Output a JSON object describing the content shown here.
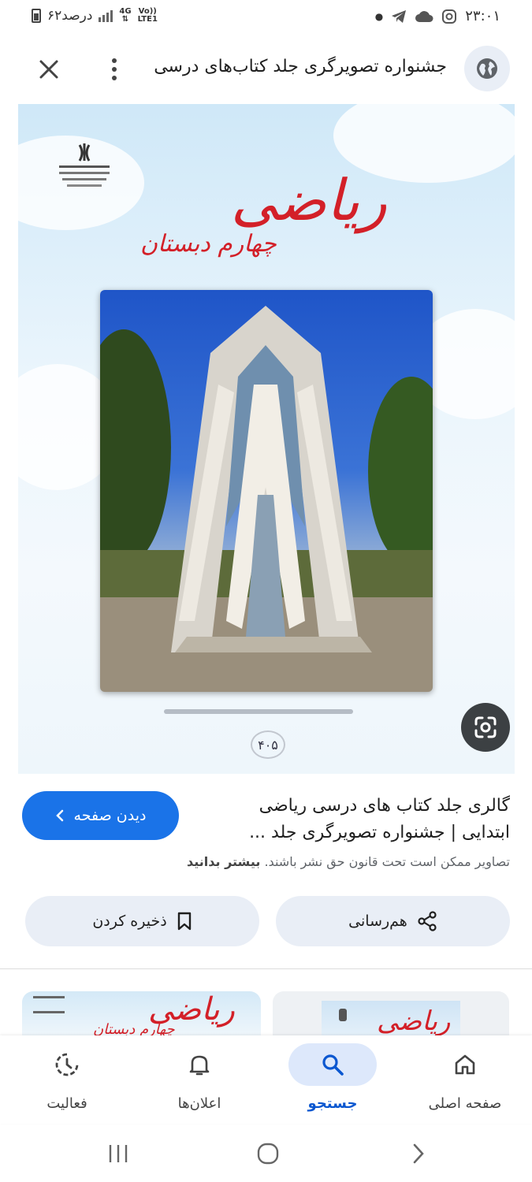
{
  "status_bar": {
    "time": "۲۳:۰۱",
    "battery_text": "۶۲درصد",
    "network_label": "4G",
    "volte_label": "Vo))",
    "lte_label": "LTE1"
  },
  "header": {
    "title": "جشنواره تصویرگری جلد کتاب‌های درسی"
  },
  "image": {
    "book_title": "ریاضی",
    "book_subtitle": "چهارم دبستان",
    "book_number": "۴۰۵",
    "thumb_title": "ریاضی",
    "thumb_subtitle": "چهارم دبستان"
  },
  "result": {
    "title_line1": "گالری جلد کتاب های درسی ریاضی",
    "title_line2": "ابتدایی | جشنواره تصویرگری جلد ...",
    "visit_button": "دیدن صفحه",
    "copyright_text": "تصاویر ممکن است تحت قانون حق نشر باشند.",
    "learn_more": "بیشتر بدانید"
  },
  "actions": {
    "share_label": "هم‌رسانی",
    "save_label": "ذخیره کردن"
  },
  "bottom_nav": {
    "home": "صفحه اصلی",
    "search": "جستجو",
    "notifications": "اعلان‌ها",
    "activity": "فعالیت"
  },
  "colors": {
    "accent": "#1a73e8",
    "active_pill": "#dde8fb",
    "title_red": "#d32028"
  },
  "icons": [
    "globe-icon",
    "more-vert-icon",
    "close-icon",
    "lens-icon",
    "share-icon",
    "bookmark-icon",
    "home-icon",
    "search-icon",
    "bell-icon",
    "activity-icon",
    "recents-icon",
    "home-circle-icon",
    "back-icon"
  ]
}
